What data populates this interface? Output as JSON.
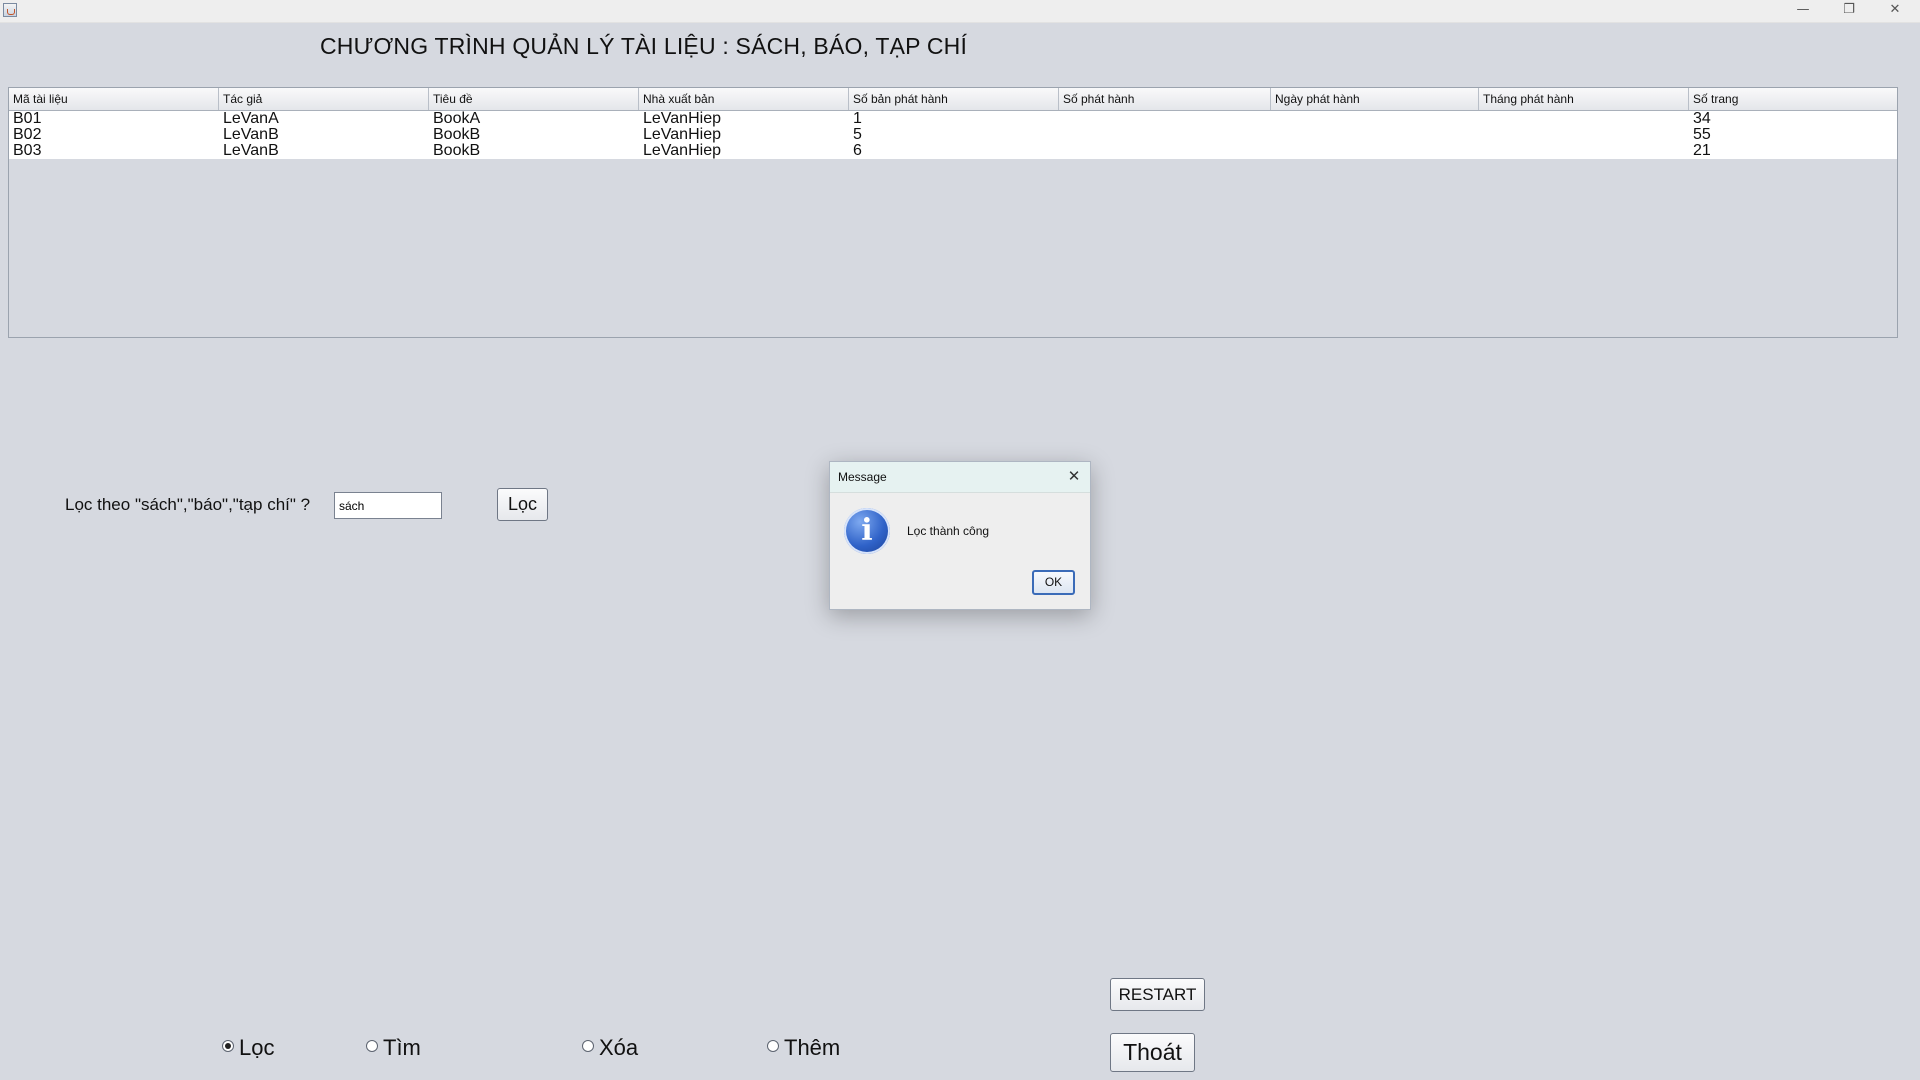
{
  "window": {
    "minimize_glyph": "—",
    "maximize_glyph": "❐",
    "close_glyph": "✕"
  },
  "title": "CHƯƠNG TRÌNH QUẢN LÝ TÀI LIỆU : SÁCH, BÁO, TẠP CHÍ",
  "table": {
    "columns": [
      "Mã tài liệu",
      "Tác giả",
      "Tiêu đề",
      "Nhà xuất bản",
      "Số bản phát hành",
      "Số phát hành",
      "Ngày phát hành",
      "Tháng phát hành",
      "Số trang"
    ],
    "rows": [
      [
        "B01",
        "LeVanA",
        "BookA",
        "LeVanHiep",
        "1",
        "",
        "",
        "",
        "34"
      ],
      [
        "B02",
        "LeVanB",
        "BookB",
        "LeVanHiep",
        "5",
        "",
        "",
        "",
        "55"
      ],
      [
        "B03",
        "LeVanB",
        "BookB",
        "LeVanHiep",
        "6",
        "",
        "",
        "",
        "21"
      ]
    ]
  },
  "filter": {
    "label": "Lọc theo \"sách\",\"báo\",\"tạp chí\" ?",
    "value": "sách",
    "button_label": "Lọc"
  },
  "actions": {
    "restart_label": "RESTART",
    "exit_label": "Thoát"
  },
  "modes": {
    "selected": "Lọc",
    "options": [
      "Lọc",
      "Tìm",
      "Xóa",
      "Thêm"
    ]
  },
  "dialog": {
    "title": "Message",
    "message": "Lọc thành công",
    "ok_label": "OK",
    "icon": "info-icon",
    "icon_glyph": "i",
    "close_glyph": "✕"
  }
}
